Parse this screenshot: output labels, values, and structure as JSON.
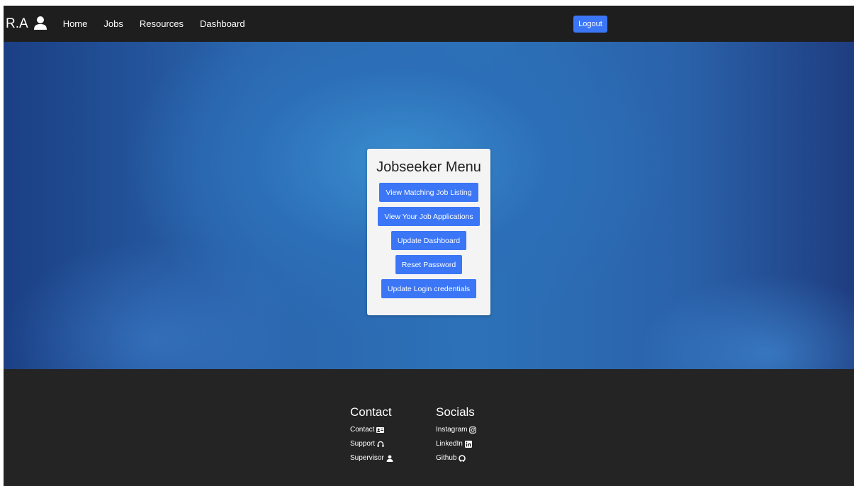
{
  "nav": {
    "brand": "R.A",
    "brand_icon": "user-icon",
    "links": [
      "Home",
      "Jobs",
      "Resources",
      "Dashboard"
    ],
    "logout_label": "Logout"
  },
  "menu": {
    "title": "Jobseeker Menu",
    "buttons": [
      "View Matching Job Listing",
      "View Your Job Applications",
      "Update Dashboard",
      "Reset Password",
      "Update Login credentials"
    ]
  },
  "footer": {
    "contact": {
      "heading": "Contact",
      "items": [
        {
          "label": "Contact",
          "icon": "address-card-icon"
        },
        {
          "label": "Support",
          "icon": "headset-icon"
        },
        {
          "label": "Supervisor",
          "icon": "user-icon"
        }
      ]
    },
    "socials": {
      "heading": "Socials",
      "items": [
        {
          "label": "Instagram",
          "icon": "instagram-icon"
        },
        {
          "label": "LinkedIn",
          "icon": "linkedin-icon"
        },
        {
          "label": "Github",
          "icon": "github-icon"
        }
      ]
    }
  },
  "colors": {
    "navbar": "#1e1e1e",
    "accent": "#3b76f6",
    "footer": "#242424",
    "card": "#f4f4f4"
  }
}
